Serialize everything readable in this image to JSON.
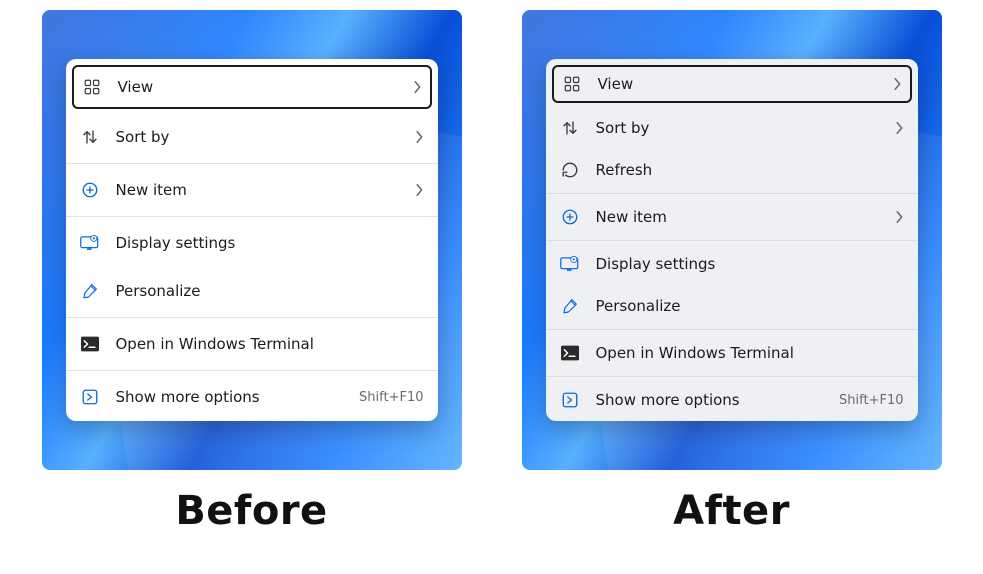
{
  "labels": {
    "before": "Before",
    "after": "After"
  },
  "menus": {
    "before": {
      "items": [
        {
          "label": "View",
          "icon": "grid-icon",
          "chevron": true,
          "selected": true
        },
        {
          "label": "Sort by",
          "icon": "sort-icon",
          "chevron": true
        },
        {
          "sep": true
        },
        {
          "label": "New item",
          "icon": "plus-circle-icon",
          "chevron": true
        },
        {
          "sep": true
        },
        {
          "label": "Display settings",
          "icon": "display-settings-icon"
        },
        {
          "label": "Personalize",
          "icon": "paintbrush-icon"
        },
        {
          "sep": true
        },
        {
          "label": "Open in Windows Terminal",
          "icon": "terminal-icon"
        },
        {
          "sep": true
        },
        {
          "label": "Show more options",
          "icon": "more-options-icon",
          "hint": "Shift+F10"
        }
      ]
    },
    "after": {
      "items": [
        {
          "label": "View",
          "icon": "grid-icon",
          "chevron": true,
          "selected": true
        },
        {
          "label": "Sort by",
          "icon": "sort-icon",
          "chevron": true
        },
        {
          "label": "Refresh",
          "icon": "refresh-icon"
        },
        {
          "sep": true
        },
        {
          "label": "New item",
          "icon": "plus-circle-icon",
          "chevron": true
        },
        {
          "sep": true
        },
        {
          "label": "Display settings",
          "icon": "display-settings-icon"
        },
        {
          "label": "Personalize",
          "icon": "paintbrush-icon"
        },
        {
          "sep": true
        },
        {
          "label": "Open in Windows Terminal",
          "icon": "terminal-icon"
        },
        {
          "sep": true
        },
        {
          "label": "Show more options",
          "icon": "more-options-icon",
          "hint": "Shift+F10"
        }
      ]
    }
  }
}
